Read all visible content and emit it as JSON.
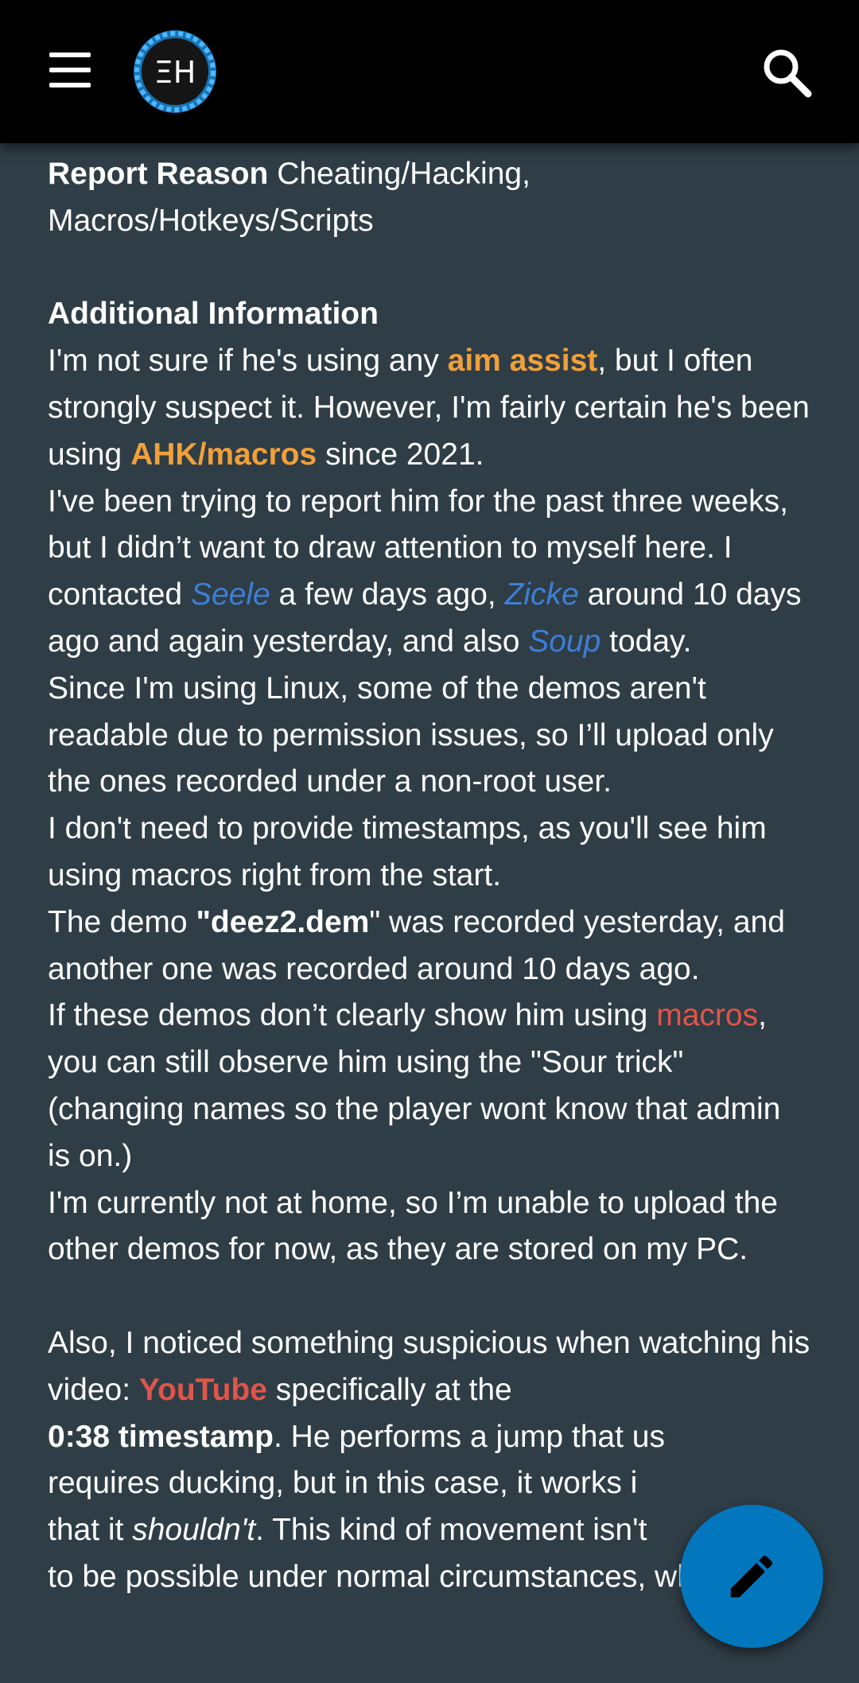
{
  "header": {
    "menu_icon": "hamburger-menu-icon",
    "logo_text": "ΞH",
    "search_icon": "search-icon"
  },
  "post": {
    "report_reason_label": "Report Reason",
    "report_reason_value": "Cheating/Hacking, Macros/Hotkeys/Scripts",
    "additional_info_label": "Additional Information",
    "p1": {
      "t1": "I'm not sure if he's using any ",
      "link_aim": "aim assist",
      "t2": ", but I often strongly suspect it. However, I'm fairly certain he's been using ",
      "link_ahk": "AHK/macros",
      "t3": " since 2021."
    },
    "p2": {
      "t1": "I've been trying to report him for the past three weeks, but I didn’t want to draw attention to myself here. I contacted ",
      "mention1": "Seele",
      "t2": " a few days ago, ",
      "mention2": "Zicke",
      "t3": " around 10 days ago and again yesterday, and also ",
      "mention3": "Soup",
      "t4": " today."
    },
    "p3": "Since I'm using Linux, some of the demos aren't readable due to permission issues, so I’ll upload only the ones recorded under a non-root user.",
    "p4": "I don't need to provide timestamps, as you'll see him using macros right from the start.",
    "p5": {
      "t1": "The demo ",
      "demo_name": "\"deez2.dem",
      "t2": "\" was recorded yesterday, and another one was recorded around 10 days ago."
    },
    "p6": {
      "t1": "If these demos don’t clearly show him using ",
      "link_macros": "macros",
      "t2": ", you can still observe him using the \"Sour trick\" (changing names so the player wont know that admin is on.)"
    },
    "p7": "I'm currently not at home, so I’m unable to upload the other demos for now, as they are stored on my PC.",
    "p8": {
      "t1": "Also, I noticed something suspicious when watching his video: ",
      "link_youtube": "YouTube",
      "t2": " specifically at the ",
      "timestamp": "0:38 timestamp",
      "t3": ". He performs a jump that us",
      "t4": "requires ducking, but in this case, it works i",
      "t5": "that it ",
      "shouldnt": "shouldn't",
      "t6": ". This kind of movement isn't",
      "t7": "to be possible under normal circumstances, which"
    }
  },
  "fab": {
    "icon": "pencil-icon"
  },
  "colors": {
    "background": "#2f3d46",
    "topbar": "#000000",
    "link_orange": "#f0a03a",
    "mention_blue": "#3d7fd6",
    "link_red": "#e0554a",
    "fab": "#0277bd"
  }
}
